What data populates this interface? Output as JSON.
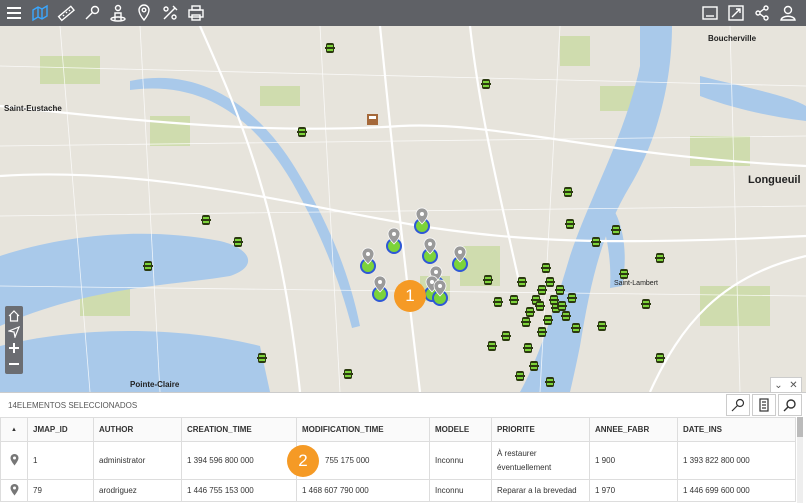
{
  "places": [
    {
      "id": "boucherville",
      "label": "Boucherville"
    },
    {
      "id": "saint-eustache",
      "label": "Saint-Eustache"
    },
    {
      "id": "longueuil",
      "label": "Longueuil"
    },
    {
      "id": "saint-lambert",
      "label": "Saint-Lambert"
    },
    {
      "id": "pointe-claire",
      "label": "Pointe-Claire"
    }
  ],
  "badges": [
    "1",
    "2"
  ],
  "panel": {
    "title": "14ELEMENTOS SELECCIONADOS",
    "sort_indicator": "▲",
    "columns": [
      "JMAP_ID",
      "AUTHOR",
      "CREATION_TIME",
      "MODIFICATION_TIME",
      "MODELE",
      "PRIORITE",
      "ANNEE_FABR",
      "DATE_INS"
    ],
    "rows": [
      [
        "1",
        "administrator",
        "1 394 596 800 000",
        "755 175 000",
        "Inconnu",
        "À restaurer éventuellement",
        "1 900",
        "1 393 822 800 000"
      ],
      [
        "79",
        "arodriguez",
        "1 446 755 153 000",
        "1 468 607 790 000",
        "Inconnu",
        "Reparar a la brevedad",
        "1 970",
        "1 446 699 600 000"
      ]
    ]
  },
  "colors": {
    "toolbar": "#5f6166",
    "accent": "#3aa7ff",
    "water": "#a9c9ea",
    "park": "#cfdcae",
    "badge": "#f59a25",
    "marker_green": "#7cd33a",
    "marker_blue": "#2e58d6"
  },
  "icons": {
    "toolbar_left": [
      "menu-icon",
      "map-layers-icon",
      "ruler-icon",
      "pushpin-icon",
      "person-icon",
      "location-pin-icon",
      "draw-icon",
      "print-icon"
    ],
    "toolbar_right": [
      "window-icon",
      "fullscreen-icon",
      "share-icon",
      "user-icon"
    ]
  }
}
